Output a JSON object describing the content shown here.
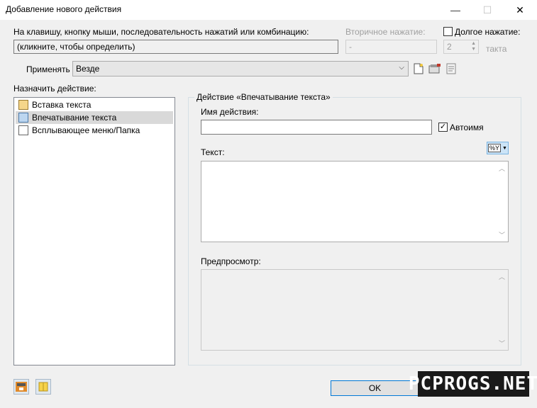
{
  "window": {
    "title": "Добавление нового действия",
    "minimize": "—",
    "maximize": "☐",
    "close": "✕"
  },
  "hotkey": {
    "label": "На клавишу, кнопку мыши, последовательность нажатий или комбинацию:",
    "value": "(кликните, чтобы определить)",
    "secondary_label": "Вторичное нажатие:",
    "secondary_value": "-",
    "long_press_label": "Долгое нажатие:",
    "long_press_value": "2",
    "long_press_unit": "такта"
  },
  "apply": {
    "label": "Применять",
    "value": "Везде"
  },
  "assign": {
    "label": "Назначить действие:",
    "items": [
      {
        "label": "Вставка текста"
      },
      {
        "label": "Впечатывание текста"
      },
      {
        "label": "Всплывающее меню/Папка"
      }
    ],
    "selected_index": 1
  },
  "action_group": {
    "title": "Действие «Впечатывание текста»",
    "name_label": "Имя действия:",
    "name_value": "",
    "autoname_label": "Автоимя",
    "autoname_checked": "✓",
    "text_label": "Текст:",
    "macro_button": "%Y",
    "preview_label": "Предпросмотр:"
  },
  "footer": {
    "ok_label": "OK"
  },
  "watermark": "PCPROGS.NET",
  "colors": {
    "accent": "#0078d7",
    "selection": "#d9d9d9"
  }
}
